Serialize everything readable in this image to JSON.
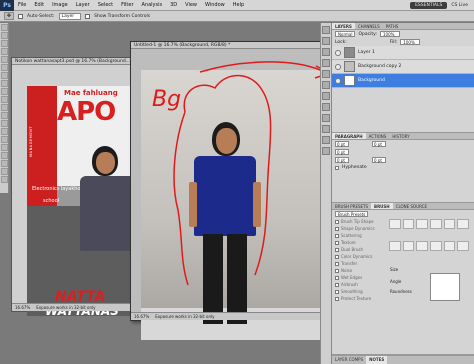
{
  "menubar": {
    "logo": "Ps",
    "items": [
      "File",
      "Edit",
      "Image",
      "Layer",
      "Select",
      "Filter",
      "Analysis",
      "3D",
      "View",
      "Window",
      "Help"
    ],
    "essentials": "ESSENTIALS",
    "cslive": "CS Live"
  },
  "options": {
    "auto_select_label": "Auto-Select:",
    "auto_select_value": "Layer",
    "transform_label": "Show Transform Controls"
  },
  "doc1": {
    "title": "Notikon wattanasapt3.psd @ 16.7% (Background...",
    "poster": {
      "name_top": "Mae fahluang",
      "apo": "APO",
      "mgmt": "MANAGEMENT",
      "dept": "Electronics layakhom",
      "school": "school",
      "name1": "NATTA",
      "name2": "WATTANAS"
    },
    "status": "16.67%",
    "status_msg": "Exposure works in 32-bit only"
  },
  "doc2": {
    "title": "Untitled-1 @ 16.7% (Background, RGB/8) *",
    "annotation": "Bg",
    "status": "16.67%",
    "status_msg": "Exposure works in 32-bit only"
  },
  "layers_panel": {
    "tabs": [
      "LAYERS",
      "CHANNELS",
      "PATHS"
    ],
    "blend_mode": "Normal",
    "opacity_label": "Opacity:",
    "opacity_value": "100%",
    "lock_label": "Lock:",
    "fill_label": "Fill:",
    "fill_value": "100%",
    "layers": [
      {
        "name": "Layer 1",
        "selected": false
      },
      {
        "name": "Background copy 2",
        "selected": false
      },
      {
        "name": "Background",
        "selected": true
      }
    ]
  },
  "paragraph_panel": {
    "tabs": [
      "PARAGRAPH",
      "ACTIONS",
      "HISTORY"
    ],
    "fields": [
      "0 pt",
      "0 pt",
      "0 pt",
      "0 pt",
      "0 pt"
    ],
    "hyphenate": "Hyphenate"
  },
  "brush_panel": {
    "tabs": [
      "BRUSH PRESETS",
      "BRUSH",
      "CLONE SOURCE"
    ],
    "presets_button": "Brush Presets",
    "items": [
      "Brush Tip Shape",
      "Shape Dynamics",
      "Scattering",
      "Texture",
      "Dual Brush",
      "Color Dynamics",
      "Transfer",
      "Noise",
      "Wet Edges",
      "Airbrush",
      "Smoothing",
      "Protect Texture"
    ],
    "size_label": "Size",
    "angle_label": "Angle",
    "roundness_label": "Roundness"
  },
  "bottom_tabs": [
    "LAYER COMPS",
    "NOTES"
  ],
  "colors": {
    "selection_blue": "#3d7ee0",
    "annotation_red": "#e01a1a"
  }
}
